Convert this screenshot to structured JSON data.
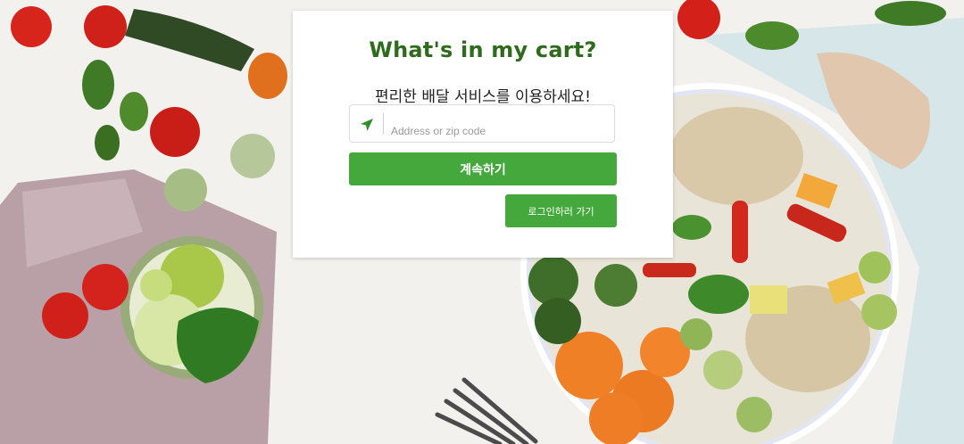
{
  "card": {
    "title": "What's in my cart?",
    "subtitle": "편리한 배달 서비스를 이용하세요!",
    "address": {
      "value": "",
      "placeholder": "Address or zip code",
      "icon": "location-arrow-icon"
    },
    "continue_label": "계속하기",
    "login_label": "로그인하러 가기"
  },
  "colors": {
    "accent": "#45a83d",
    "title": "#2f6b1c"
  }
}
